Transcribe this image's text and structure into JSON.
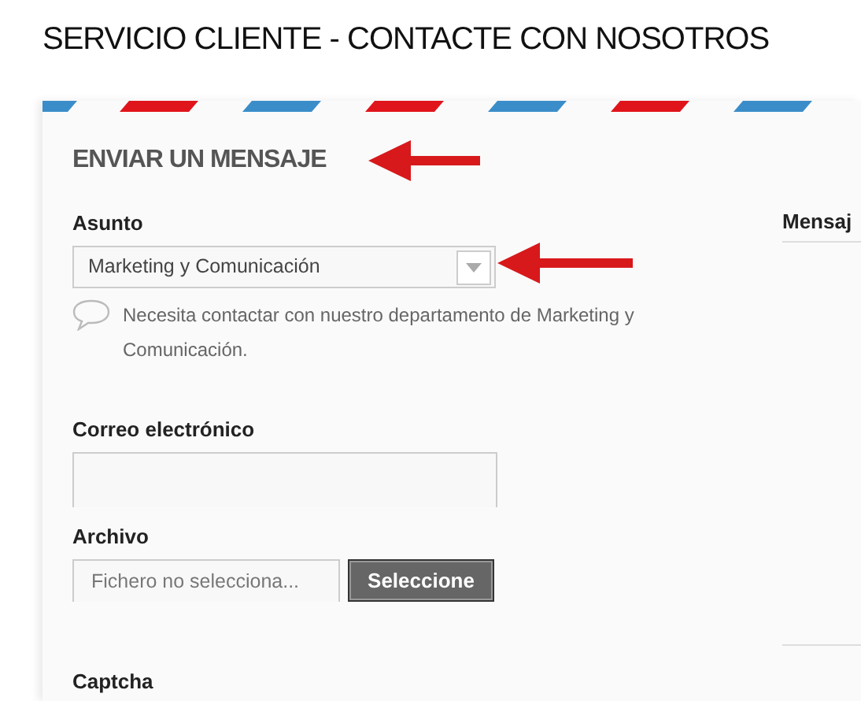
{
  "page_title": "SERVICIO CLIENTE - CONTACTE CON NOSOTROS",
  "form": {
    "title": "ENVIAR UN MENSAJE",
    "fields": [
      {
        "kind": "select",
        "label": "Asunto",
        "value": "Marketing y Comunicación",
        "hint": "Necesita contactar con nuestro departamento de Marketing y Comunicación."
      },
      {
        "kind": "text",
        "label": "Correo electrónico"
      },
      {
        "kind": "file",
        "label": "Archivo",
        "value": "Fichero no selecciona...",
        "button": "Seleccione"
      },
      {
        "kind": "label",
        "label": "Captcha"
      }
    ]
  },
  "message_column": {
    "label": "Mensaj"
  }
}
